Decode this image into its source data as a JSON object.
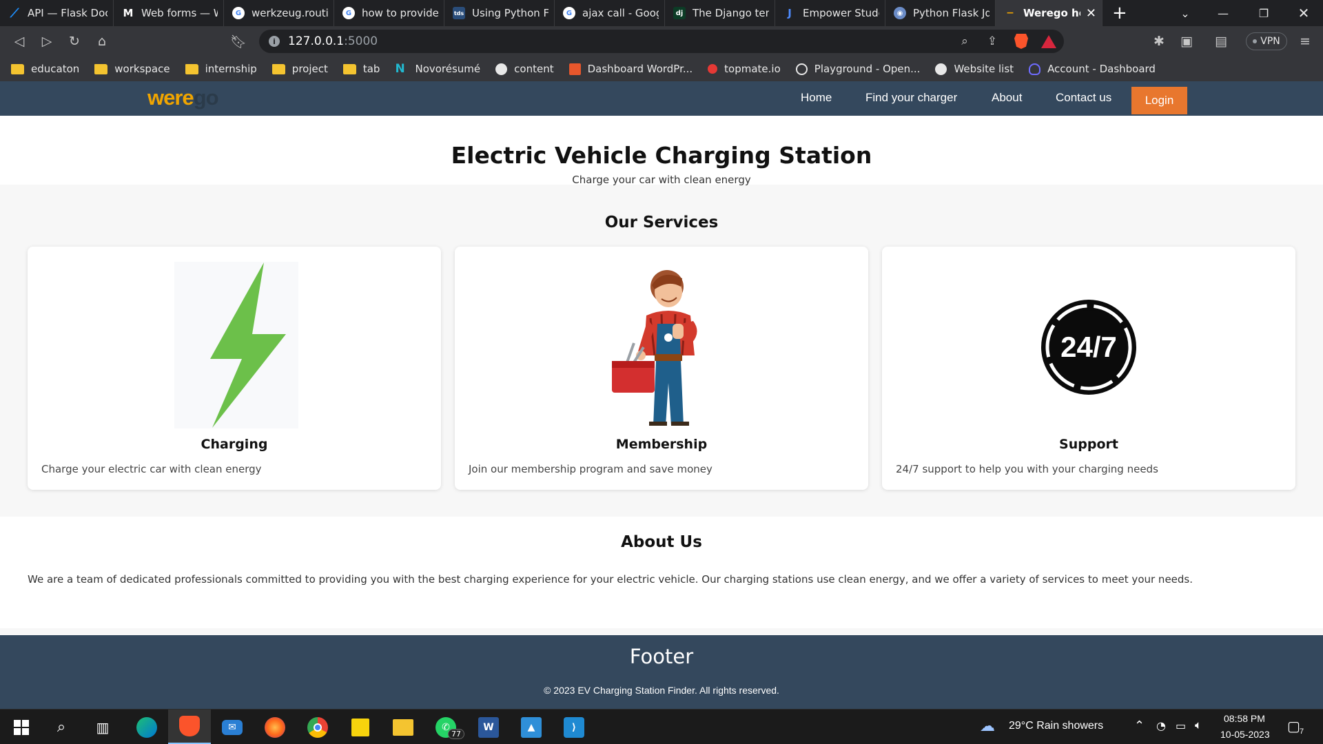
{
  "browser": {
    "tabs": [
      {
        "title": "API — Flask Docu",
        "icon": "flask-doc-icon",
        "color": "#1e90ff",
        "glyph": "⟋"
      },
      {
        "title": "Web forms — W",
        "icon": "medium-icon",
        "color": "#ffffff",
        "glyph": "M"
      },
      {
        "title": "werkzeug.routing",
        "icon": "google-icon",
        "color": "#ffffff",
        "glyph": "G"
      },
      {
        "title": "how to provide li",
        "icon": "google-icon",
        "color": "#ffffff",
        "glyph": "G"
      },
      {
        "title": "Using Python Fla",
        "icon": "tds-icon",
        "color": "#2a4d7a",
        "glyph": "tds"
      },
      {
        "title": "ajax call - Googl",
        "icon": "google-icon",
        "color": "#ffffff",
        "glyph": "G"
      },
      {
        "title": "The Django temp",
        "icon": "django-icon",
        "color": "#0c3c26",
        "glyph": "dj"
      },
      {
        "title": "Empower Studen",
        "icon": "empower-icon",
        "color": "#2d6cdf",
        "glyph": "J"
      },
      {
        "title": "Python Flask Jqu",
        "icon": "python-flask-icon",
        "color": "#6b8cc7",
        "glyph": "◉"
      }
    ],
    "active_tab": {
      "title": "Werego hom",
      "icon": "werego-icon",
      "close": "✕"
    },
    "new_tab": "+",
    "url_host": "127.0.0.1",
    "url_port": ":5000",
    "vpn_label": "VPN",
    "bookmarks": [
      {
        "label": "educaton",
        "icon": "folder-icon"
      },
      {
        "label": "workspace",
        "icon": "folder-icon"
      },
      {
        "label": "internship",
        "icon": "folder-icon"
      },
      {
        "label": "project",
        "icon": "folder-icon"
      },
      {
        "label": "tab",
        "icon": "folder-icon"
      },
      {
        "label": "Novorésumé",
        "icon": "novoresume-icon"
      },
      {
        "label": "content",
        "icon": "globe-icon"
      },
      {
        "label": "Dashboard WordPr...",
        "icon": "wordpress-dashboard-icon"
      },
      {
        "label": "topmate.io",
        "icon": "topmate-icon"
      },
      {
        "label": "Playground - Open...",
        "icon": "openai-icon"
      },
      {
        "label": "Website list",
        "icon": "globe-icon"
      },
      {
        "label": "Account - Dashboard",
        "icon": "account-icon"
      }
    ]
  },
  "site": {
    "logo_main": "were",
    "logo_accent": "go",
    "nav": {
      "home": "Home",
      "find_charger": "Find your charger",
      "about": "About",
      "contact": "Contact us",
      "login": "Login"
    },
    "hero": {
      "title": "Electric Vehicle Charging Station",
      "subtitle": "Charge your car with clean energy"
    },
    "services": {
      "heading": "Our Services",
      "cards": [
        {
          "title": "Charging",
          "description": "Charge your electric car with clean energy",
          "image": "lightning-bolt-icon"
        },
        {
          "title": "Membership",
          "description": "Join our membership program and save money",
          "image": "mechanic-illustration"
        },
        {
          "title": "Support",
          "description": "24/7 support to help you with your charging needs",
          "image": "support-24-7-icon"
        }
      ],
      "support_badge_text": "24/7"
    },
    "about": {
      "heading": "About Us",
      "text": "We are a team of dedicated professionals committed to providing you with the best charging experience for your electric vehicle. Our charging stations use clean energy, and we offer a variety of services to meet your needs."
    },
    "footer": {
      "title": "Footer",
      "copyright": "© 2023 EV Charging Station Finder. All rights reserved."
    }
  },
  "taskbar": {
    "whatsapp_badge": "77",
    "weather": "29°C  Rain showers",
    "time": "08:58 PM",
    "date": "10-05-2023",
    "notifications": "7"
  },
  "colors": {
    "nav_bg": "#34485d",
    "login_bg": "#e8772e",
    "logo": "#f0a500",
    "bolt": "#6cc04a"
  }
}
